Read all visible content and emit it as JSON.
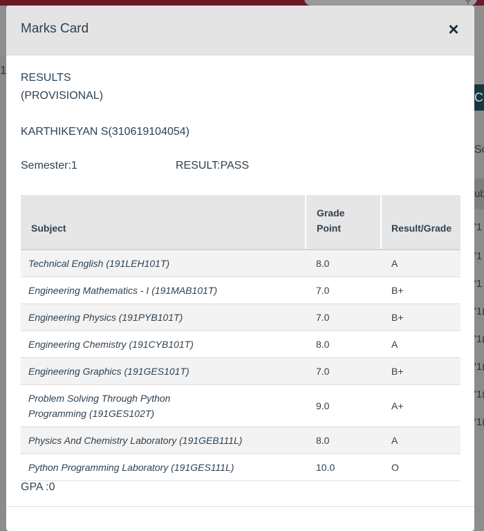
{
  "modal": {
    "title": "Marks Card",
    "close_icon": "×"
  },
  "report": {
    "results_line1": "RESULTS",
    "results_line2": "(PROVISIONAL)",
    "student": "KARTHIKEYAN S(310619104054)",
    "semester": "Semester:1",
    "result": "RESULT:PASS",
    "gpa": "GPA :0"
  },
  "table": {
    "headers": {
      "subject": "Subject",
      "grade_point_1": "Grade",
      "grade_point_2": "Point",
      "result_grade": "Result/Grade"
    },
    "rows": [
      {
        "subject": "Technical English (191LEH101T)",
        "grade_point": "8.0",
        "grade": "A"
      },
      {
        "subject": "Engineering Mathematics - I (191MAB101T)",
        "grade_point": "7.0",
        "grade": "B+"
      },
      {
        "subject": "Engineering Physics (191PYB101T)",
        "grade_point": "7.0",
        "grade": "B+"
      },
      {
        "subject": "Engineering Chemistry (191CYB101T)",
        "grade_point": "8.0",
        "grade": "A"
      },
      {
        "subject": "Engineering Graphics (191GES101T)",
        "grade_point": "7.0",
        "grade": "B+"
      },
      {
        "subject": "Problem Solving Through Python Programming (191GES102T)",
        "grade_point": "9.0",
        "grade": "A+"
      },
      {
        "subject": "Physics And Chemistry Laboratory (191GEB111L)",
        "grade_point": "8.0",
        "grade": "A"
      },
      {
        "subject": "Python Programming Laboratory (191GES111L)",
        "grade_point": "10.0",
        "grade": "O"
      }
    ]
  },
  "background": {
    "left_char": "1",
    "right_button": "C",
    "right_text": "Sc",
    "right_header": "ub",
    "right_cells": [
      "'1",
      "'1",
      "'1",
      "'1(",
      "'1(",
      "'1(",
      "'1(",
      "'1("
    ]
  },
  "colors": {
    "top_bar": "#6b1a26",
    "modal_header": "#e4e4e4",
    "text": "#2f4150"
  }
}
